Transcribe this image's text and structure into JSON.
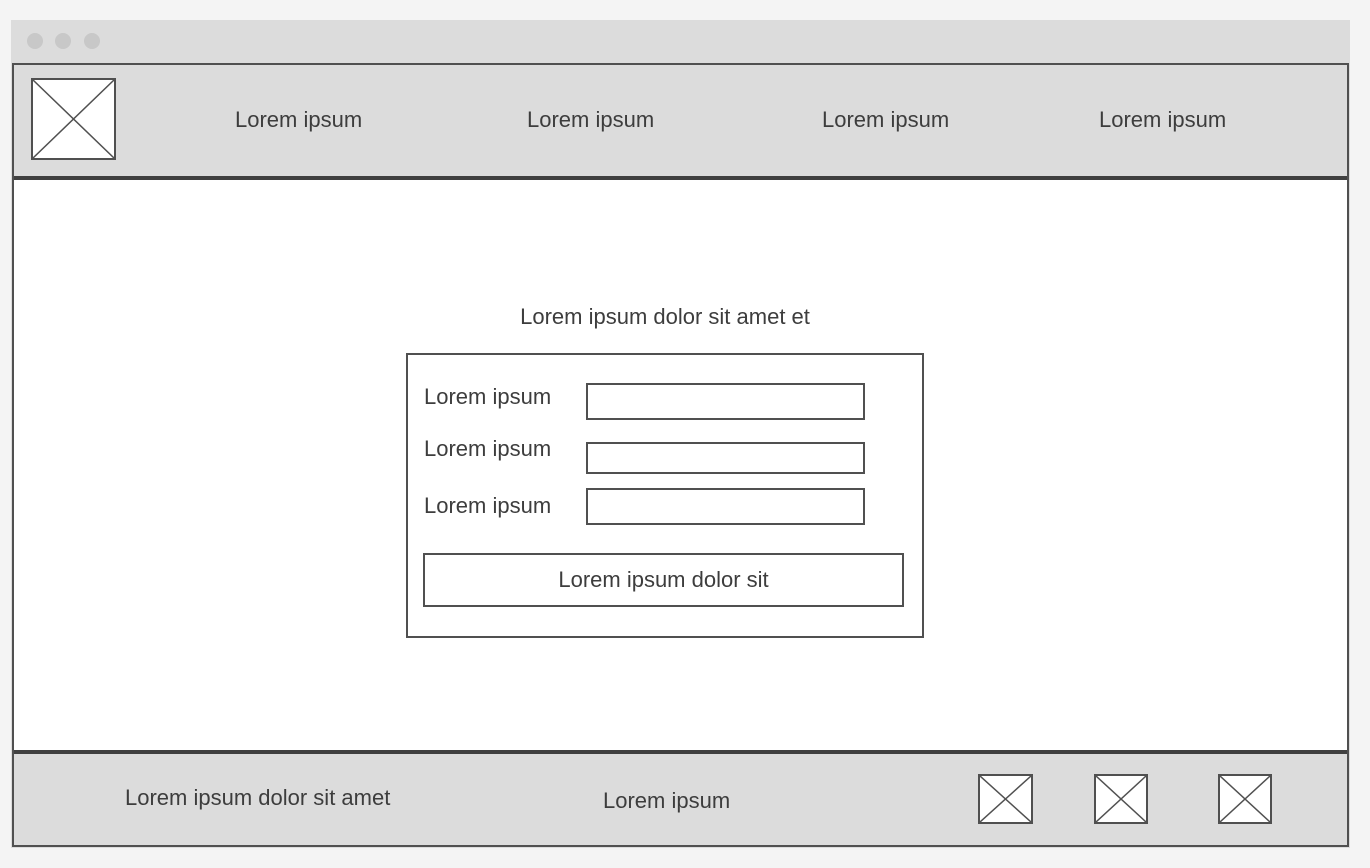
{
  "header": {
    "logo_icon": "image-placeholder-icon",
    "nav": [
      {
        "label": "Lorem ipsum"
      },
      {
        "label": "Lorem ipsum"
      },
      {
        "label": "Lorem ipsum"
      },
      {
        "label": "Lorem ipsum"
      }
    ]
  },
  "form": {
    "title": "Lorem ipsum dolor sit amet et",
    "fields": [
      {
        "label": "Lorem ipsum",
        "value": "",
        "placeholder": ""
      },
      {
        "label": "Lorem ipsum",
        "value": "",
        "placeholder": ""
      },
      {
        "label": "Lorem ipsum",
        "value": "",
        "placeholder": ""
      }
    ],
    "submit_label": "Lorem ipsum dolor sit"
  },
  "footer": {
    "text_primary": "Lorem ipsum dolor sit amet",
    "text_secondary": "Lorem ipsum",
    "icons": [
      "image-placeholder-icon",
      "image-placeholder-icon",
      "image-placeholder-icon"
    ]
  },
  "colors": {
    "chrome": "#dcdcdc",
    "border": "#505050",
    "text": "#3d3d3d",
    "content_bg": "#ffffff"
  }
}
